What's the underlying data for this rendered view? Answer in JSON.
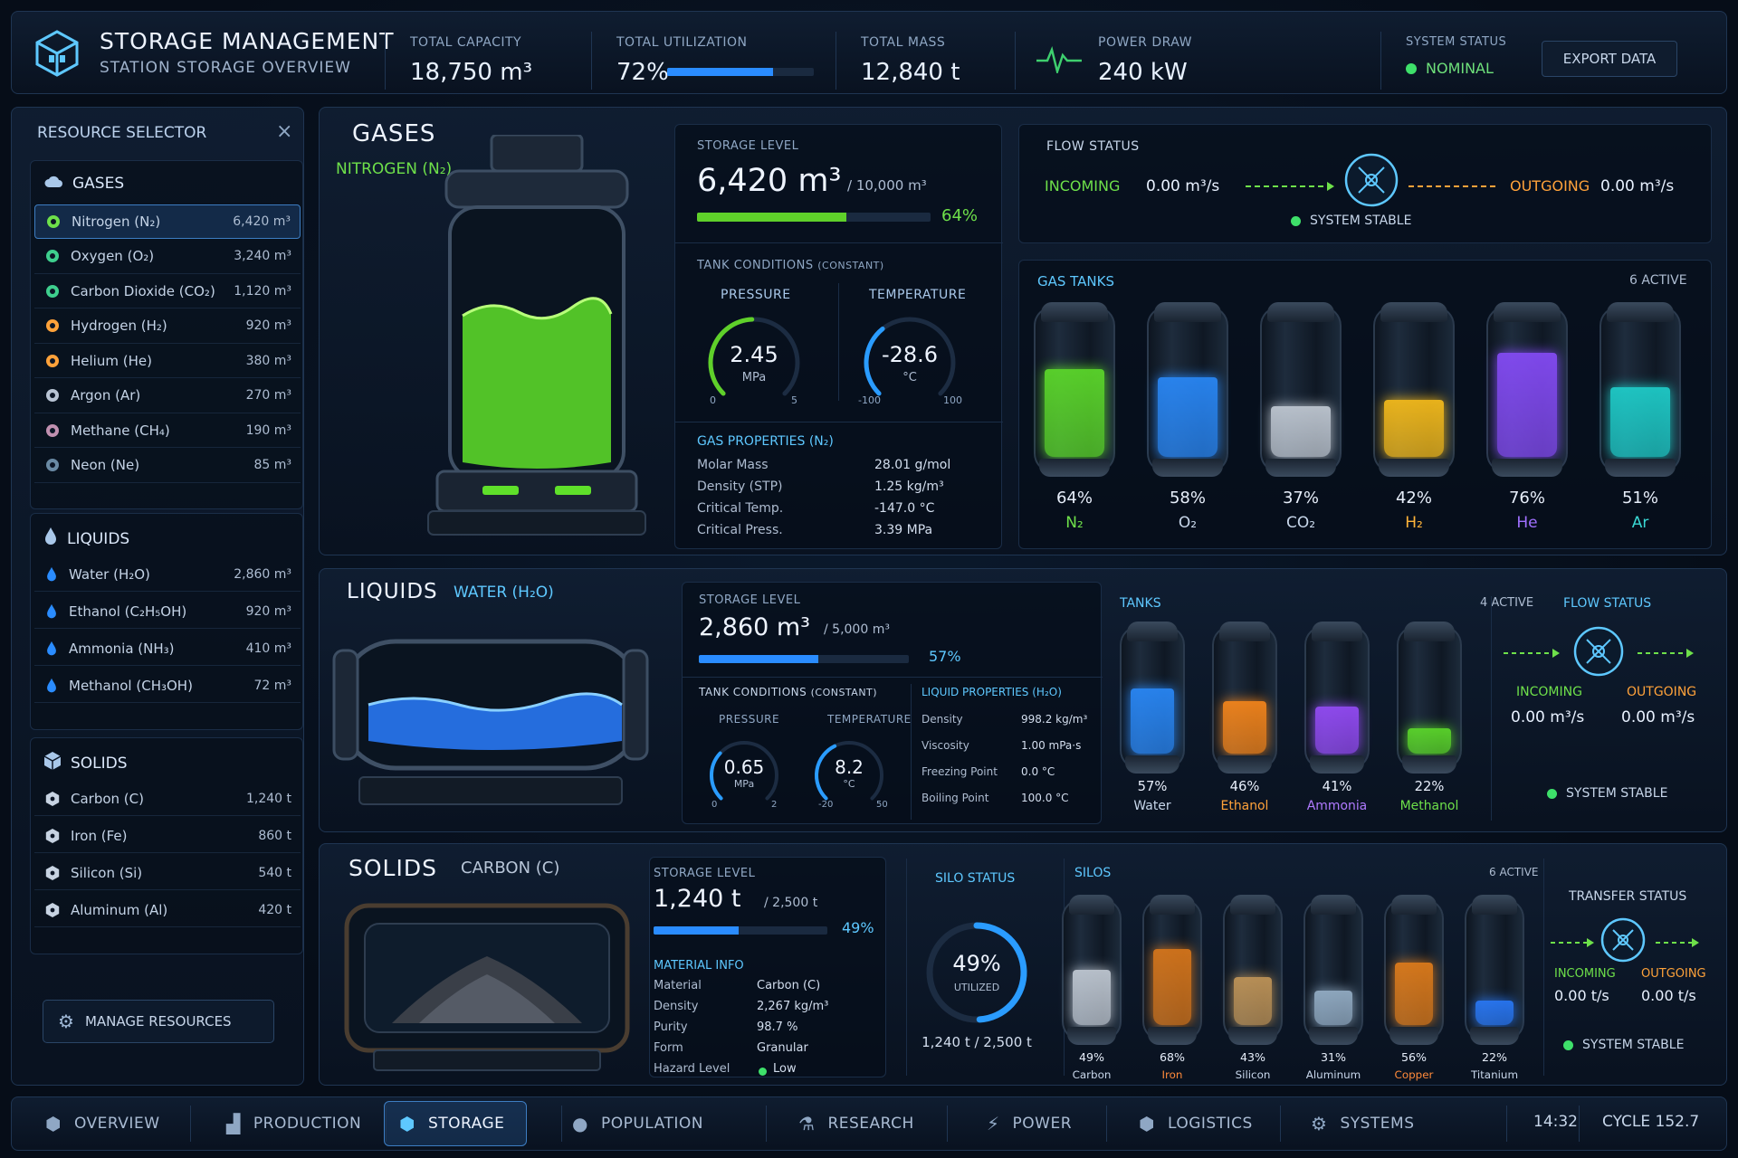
{
  "header": {
    "title": "STORAGE MANAGEMENT",
    "subtitle": "STATION STORAGE OVERVIEW",
    "capacity_label": "TOTAL CAPACITY",
    "capacity": "18,750 m³",
    "util_label": "TOTAL UTILIZATION",
    "util": "72%",
    "util_fraction": 0.72,
    "mass_label": "TOTAL MASS",
    "mass": "12,840 t",
    "power_label": "POWER DRAW",
    "power": "240 kW",
    "status_label": "SYSTEM STATUS",
    "status": "NOMINAL",
    "export": "EXPORT DATA"
  },
  "sidebar": {
    "title": "RESOURCE SELECTOR",
    "close": "×",
    "manage": "MANAGE RESOURCES",
    "gases_title": "GASES",
    "liquids_title": "LIQUIDS",
    "solids_title": "SOLIDS",
    "gases": [
      {
        "n": "Nitrogen (N₂)",
        "v": "6,420 m³",
        "c": "#6ee04a"
      },
      {
        "n": "Oxygen (O₂)",
        "v": "3,240 m³",
        "c": "#3ecf8e"
      },
      {
        "n": "Carbon Dioxide (CO₂)",
        "v": "1,120 m³",
        "c": "#3ecf8e"
      },
      {
        "n": "Hydrogen (H₂)",
        "v": "920 m³",
        "c": "#ffa23a"
      },
      {
        "n": "Helium (He)",
        "v": "380 m³",
        "c": "#ffa23a"
      },
      {
        "n": "Argon (Ar)",
        "v": "270 m³",
        "c": "#b8c4d4"
      },
      {
        "n": "Methane (CH₄)",
        "v": "190 m³",
        "c": "#c090b0"
      },
      {
        "n": "Neon (Ne)",
        "v": "85 m³",
        "c": "#6a8aa4"
      }
    ],
    "liquids": [
      {
        "n": "Water (H₂O)",
        "v": "2,860 m³"
      },
      {
        "n": "Ethanol (C₂H₅OH)",
        "v": "920 m³"
      },
      {
        "n": "Ammonia (NH₃)",
        "v": "410 m³"
      },
      {
        "n": "Methanol (CH₃OH)",
        "v": "72 m³"
      }
    ],
    "solids": [
      {
        "n": "Carbon (C)",
        "v": "1,240 t"
      },
      {
        "n": "Iron (Fe)",
        "v": "860 t"
      },
      {
        "n": "Silicon (Si)",
        "v": "540 t"
      },
      {
        "n": "Aluminum (Al)",
        "v": "420 t"
      }
    ]
  },
  "gases": {
    "title": "GASES",
    "selected": "NITROGEN (N₂)",
    "storage_label": "STORAGE LEVEL",
    "storage": "6,420 m³",
    "cap": "/ 10,000 m³",
    "pct": "64%",
    "fraction": 0.64,
    "cond_label": "TANK CONDITIONS",
    "cond_note": "(CONSTANT)",
    "pressure_label": "PRESSURE",
    "pressure": "2.45",
    "pressure_unit": "MPa",
    "p_min": "0",
    "p_max": "5",
    "p_frac": 0.49,
    "temp_label": "TEMPERATURE",
    "temp": "-28.6",
    "temp_unit": "°C",
    "t_min": "-100",
    "t_max": "100",
    "t_frac": 0.357,
    "props_title": "GAS PROPERTIES (N₂)",
    "props": [
      {
        "k": "Molar Mass",
        "v": "28.01 g/mol"
      },
      {
        "k": "Density (STP)",
        "v": "1.25 kg/m³"
      },
      {
        "k": "Critical Temp.",
        "v": "-147.0 °C"
      },
      {
        "k": "Critical Press.",
        "v": "3.39 MPa"
      }
    ],
    "flow_label": "FLOW STATUS",
    "incoming_label": "INCOMING",
    "incoming": "0.00 m³/s",
    "outgoing_label": "OUTGOING",
    "outgoing": "0.00 m³/s",
    "stable": "SYSTEM STABLE",
    "tanks_label": "GAS TANKS",
    "active": "6 ACTIVE",
    "tanks": [
      {
        "p": "64%",
        "f": 0.64,
        "n": "N₂",
        "c": "#5fe02a",
        "nc": "#6ee04a"
      },
      {
        "p": "58%",
        "f": 0.58,
        "n": "O₂",
        "c": "#2a8cff",
        "nc": "#c7d6ea"
      },
      {
        "p": "37%",
        "f": 0.37,
        "n": "CO₂",
        "c": "#c8d0da",
        "nc": "#c7d6ea"
      },
      {
        "p": "42%",
        "f": 0.42,
        "n": "H₂",
        "c": "#ffc21a",
        "nc": "#ffb43a"
      },
      {
        "p": "76%",
        "f": 0.76,
        "n": "He",
        "c": "#8a4dff",
        "nc": "#a070ff"
      },
      {
        "p": "51%",
        "f": 0.51,
        "n": "Ar",
        "c": "#1fd4d0",
        "nc": "#3ad8d4"
      }
    ]
  },
  "liquids": {
    "title": "LIQUIDS",
    "selected": "WATER (H₂O)",
    "storage_label": "STORAGE LEVEL",
    "storage": "2,860 m³",
    "cap": "/ 5,000 m³",
    "pct": "57%",
    "fraction": 0.57,
    "cond_label": "TANK CONDITIONS",
    "cond_note": "(CONSTANT)",
    "pressure_label": "PRESSURE",
    "pressure": "0.65",
    "pressure_unit": "MPa",
    "p_min": "0",
    "p_max": "2",
    "p_frac": 0.325,
    "temp_label": "TEMPERATURE",
    "temp": "8.2",
    "temp_unit": "°C",
    "t_min": "-20",
    "t_max": "50",
    "t_frac": 0.403,
    "props_title": "LIQUID PROPERTIES (H₂O)",
    "props": [
      {
        "k": "Density",
        "v": "998.2 kg/m³"
      },
      {
        "k": "Viscosity",
        "v": "1.00 mPa·s"
      },
      {
        "k": "Freezing Point",
        "v": "0.0 °C"
      },
      {
        "k": "Boiling Point",
        "v": "100.0 °C"
      }
    ],
    "tanks_label": "TANKS",
    "active": "4 ACTIVE",
    "tanks": [
      {
        "p": "57%",
        "f": 0.57,
        "n": "Water",
        "c": "#2a8cff",
        "nc": "#c7d6ea"
      },
      {
        "p": "46%",
        "f": 0.46,
        "n": "Ethanol",
        "c": "#ff8a1a",
        "nc": "#ffa23a"
      },
      {
        "p": "41%",
        "f": 0.41,
        "n": "Ammonia",
        "c": "#9a4dff",
        "nc": "#b07aff"
      },
      {
        "p": "22%",
        "f": 0.22,
        "n": "Methanol",
        "c": "#5fe02a",
        "nc": "#6ee04a"
      }
    ],
    "flow_label": "FLOW STATUS",
    "incoming_label": "INCOMING",
    "incoming": "0.00 m³/s",
    "outgoing_label": "OUTGOING",
    "outgoing": "0.00 m³/s",
    "stable": "SYSTEM STABLE"
  },
  "solids": {
    "title": "SOLIDS",
    "selected": "CARBON (C)",
    "storage_label": "STORAGE LEVEL",
    "storage": "1,240 t",
    "cap": "/ 2,500 t",
    "pct": "49%",
    "fraction": 0.49,
    "info_title": "MATERIAL INFO",
    "info": [
      {
        "k": "Material",
        "v": "Carbon (C)"
      },
      {
        "k": "Density",
        "v": "2,267 kg/m³"
      },
      {
        "k": "Purity",
        "v": "98.7 %"
      },
      {
        "k": "Form",
        "v": "Granular"
      },
      {
        "k": "Hazard Level",
        "v": "Low"
      }
    ],
    "silo_status_label": "SILO STATUS",
    "silo_pct": "49%",
    "silo_frac": 0.49,
    "silo_utilized": "UTILIZED",
    "silo_amount": "1,240 t / 2,500 t",
    "silos_label": "SILOS",
    "active": "6 ACTIVE",
    "silos": [
      {
        "p": "49%",
        "f": 0.49,
        "n": "Carbon",
        "c": "#c8d0da",
        "nc": "#c7d6ea"
      },
      {
        "p": "68%",
        "f": 0.68,
        "n": "Iron",
        "c": "#e07a1a",
        "nc": "#ff8a3a"
      },
      {
        "p": "43%",
        "f": 0.43,
        "n": "Silicon",
        "c": "#c89a5a",
        "nc": "#c7d6ea"
      },
      {
        "p": "31%",
        "f": 0.31,
        "n": "Aluminum",
        "c": "#9ab4cc",
        "nc": "#c7d6ea"
      },
      {
        "p": "56%",
        "f": 0.56,
        "n": "Copper",
        "c": "#e8801a",
        "nc": "#ff8a3a"
      },
      {
        "p": "22%",
        "f": 0.22,
        "n": "Titanium",
        "c": "#2a7cff",
        "nc": "#c7d6ea"
      }
    ],
    "transfer_label": "TRANSFER STATUS",
    "incoming_label": "INCOMING",
    "incoming": "0.00 t/s",
    "outgoing_label": "OUTGOING",
    "outgoing": "0.00 t/s",
    "stable": "SYSTEM STABLE"
  },
  "nav": {
    "items": [
      "OVERVIEW",
      "PRODUCTION",
      "STORAGE",
      "POPULATION",
      "RESEARCH",
      "POWER",
      "LOGISTICS",
      "SYSTEMS"
    ],
    "active": 2,
    "time": "14:32",
    "cycle": "CYCLE 152.7"
  },
  "colors": {
    "accent": "#5ec8ff",
    "green": "#6ee04a",
    "orange": "#ffa23a",
    "bar_blue": "#2a8cff"
  }
}
